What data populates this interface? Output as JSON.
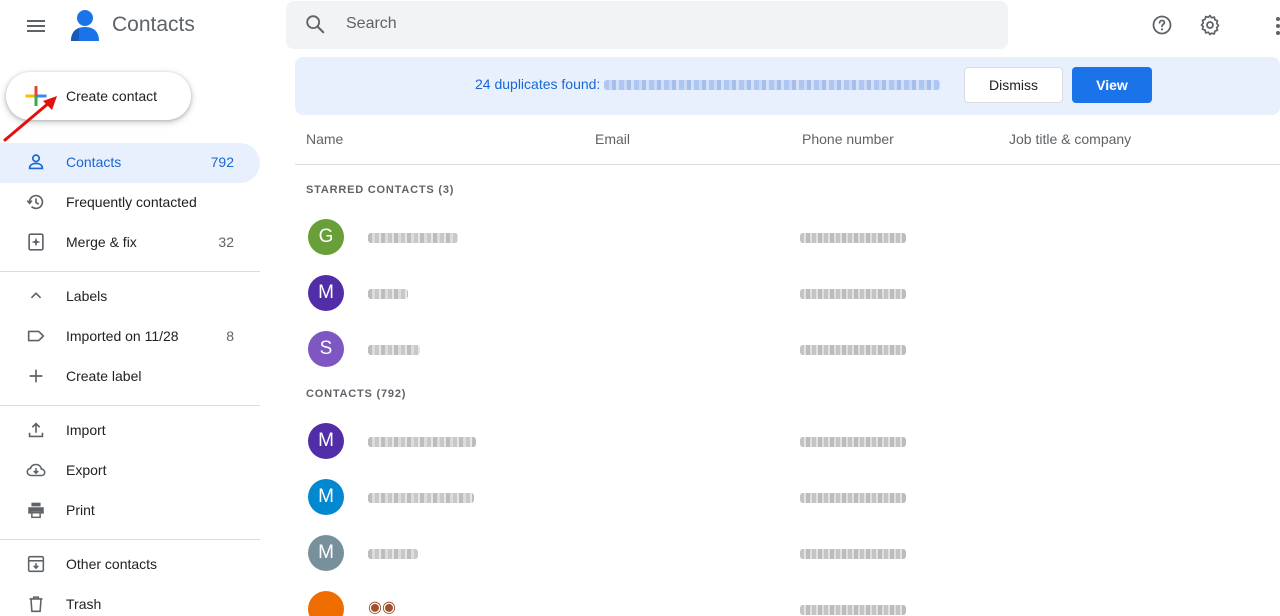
{
  "app": {
    "title": "Contacts"
  },
  "search": {
    "placeholder": "Search"
  },
  "create": {
    "label": "Create contact"
  },
  "sidebar": {
    "items": [
      {
        "label": "Contacts",
        "count": "792",
        "icon": "person-icon"
      },
      {
        "label": "Frequently contacted",
        "count": "",
        "icon": "history-icon"
      },
      {
        "label": "Merge & fix",
        "count": "32",
        "icon": "merge-fix-icon"
      },
      {
        "label": "Labels",
        "count": "",
        "icon": "chevron-up-icon"
      },
      {
        "label": "Imported on 11/28",
        "count": "8",
        "icon": "label-icon"
      },
      {
        "label": "Create label",
        "count": "",
        "icon": "plus-icon"
      },
      {
        "label": "Import",
        "count": "",
        "icon": "upload-icon"
      },
      {
        "label": "Export",
        "count": "",
        "icon": "cloud-download-icon"
      },
      {
        "label": "Print",
        "count": "",
        "icon": "printer-icon"
      },
      {
        "label": "Other contacts",
        "count": "",
        "icon": "archive-icon"
      },
      {
        "label": "Trash",
        "count": "",
        "icon": "trash-icon"
      }
    ]
  },
  "banner": {
    "text": "24 duplicates found:",
    "dismiss_label": "Dismiss",
    "view_label": "View"
  },
  "table": {
    "columns": [
      "Name",
      "Email",
      "Phone number",
      "Job title & company"
    ]
  },
  "sections": {
    "starred": "STARRED CONTACTS (3)",
    "contacts": "CONTACTS (792)"
  },
  "contacts": [
    {
      "initial": "G",
      "color": "#689f38"
    },
    {
      "initial": "M",
      "color": "#512da8"
    },
    {
      "initial": "S",
      "color": "#7e57c2"
    },
    {
      "initial": "M",
      "color": "#512da8"
    },
    {
      "initial": "M",
      "color": "#0288d1"
    },
    {
      "initial": "M",
      "color": "#78909c"
    },
    {
      "initial": "",
      "color": "#ef6c00"
    }
  ],
  "colors": {
    "accent": "#1a73e8",
    "active_bg": "#e8f0fe",
    "active_text": "#1967d2"
  }
}
